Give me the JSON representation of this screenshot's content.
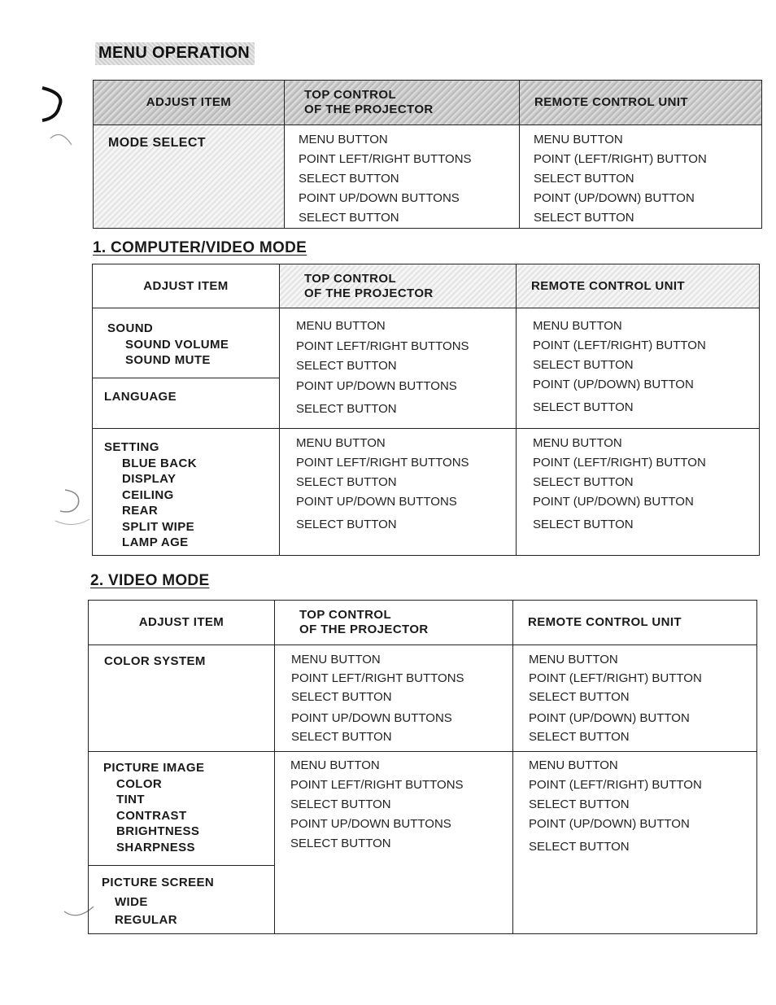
{
  "page_title": "MENU OPERATION",
  "column_headers": {
    "adjust_item": "ADJUST ITEM",
    "top_control_line1": "TOP CONTROL",
    "top_control_line2": "OF THE PROJECTOR",
    "remote_control": "REMOTE CONTROL  UNIT"
  },
  "top_control_steps": [
    "MENU BUTTON",
    "POINT LEFT/RIGHT BUTTONS",
    "SELECT BUTTON",
    "POINT UP/DOWN BUTTONS",
    "SELECT BUTTON"
  ],
  "remote_control_steps": [
    "MENU BUTTON",
    "POINT (LEFT/RIGHT) BUTTON",
    "SELECT BUTTON",
    "POINT (UP/DOWN) BUTTON",
    "SELECT BUTTON"
  ],
  "table_mode_select": {
    "rows": [
      {
        "item": "MODE SELECT",
        "subitems": []
      }
    ]
  },
  "section1": {
    "title": "1. COMPUTER/VIDEO MODE",
    "rows": [
      {
        "item": "SOUND",
        "subitems": [
          "SOUND VOLUME",
          "SOUND MUTE"
        ]
      },
      {
        "item": "LANGUAGE",
        "subitems": []
      },
      {
        "item": "SETTING",
        "subitems": [
          "BLUE BACK",
          "DISPLAY",
          "CEILING",
          "REAR",
          "SPLIT WIPE",
          "LAMP AGE"
        ]
      }
    ]
  },
  "section2": {
    "title": "2. VIDEO MODE",
    "rows": [
      {
        "item": "COLOR SYSTEM",
        "subitems": []
      },
      {
        "item": "PICTURE IMAGE",
        "subitems": [
          "COLOR",
          "TINT",
          "CONTRAST",
          "BRIGHTNESS",
          "SHARPNESS"
        ]
      },
      {
        "item": "PICTURE SCREEN",
        "subitems": [
          "WIDE",
          "REGULAR"
        ]
      }
    ]
  }
}
